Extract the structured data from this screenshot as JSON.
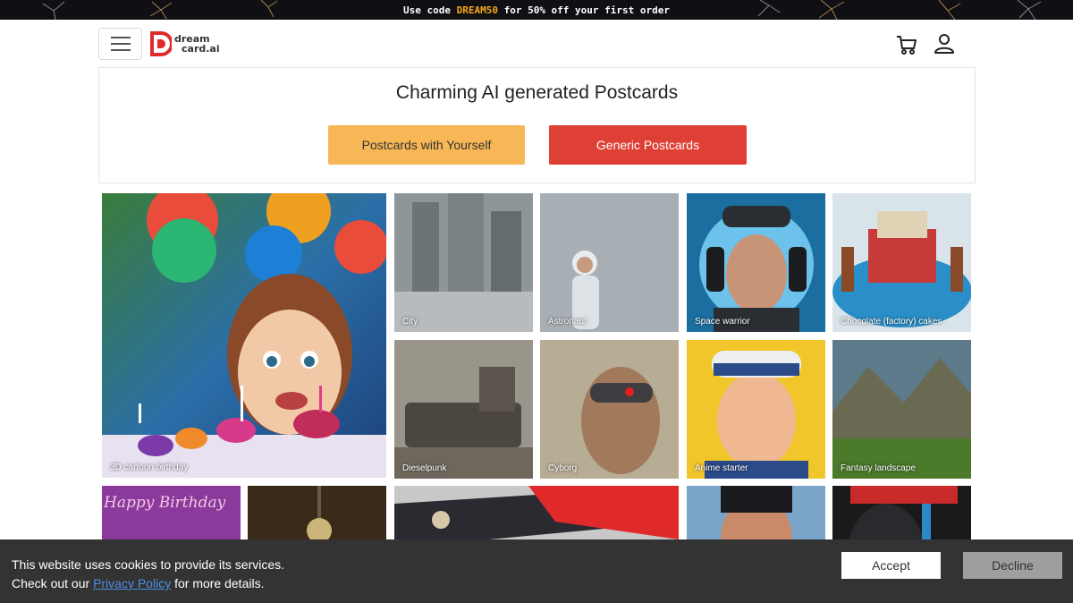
{
  "promo": {
    "prefix": "Use code",
    "code": "DREAM50",
    "suffix": "for 50% off your first order"
  },
  "header": {
    "logo_line1": "dream",
    "logo_line2": "card.ai",
    "menu_icon": "hamburger-icon",
    "cart_icon": "cart-icon",
    "user_icon": "user-icon"
  },
  "hero": {
    "title": "Charming AI generated Postcards",
    "btn_yourself": "Postcards with Yourself",
    "btn_generic": "Generic Postcards"
  },
  "cards": [
    {
      "caption": "3D cartoon birthday"
    },
    {
      "caption": "City"
    },
    {
      "caption": "Astronaut"
    },
    {
      "caption": "Space warrior"
    },
    {
      "caption": "Chocolate (factory) cakes"
    },
    {
      "caption": "Dieselpunk"
    },
    {
      "caption": "Cyborg"
    },
    {
      "caption": "Anime starter"
    },
    {
      "caption": "Fantasy landscape"
    },
    {
      "caption": "",
      "art_text": "Happy Birthday"
    },
    {
      "caption": ""
    },
    {
      "caption": ""
    },
    {
      "caption": ""
    },
    {
      "caption": ""
    }
  ],
  "cookie": {
    "line1": "This website uses cookies to provide its services.",
    "line2_prefix": "Check out our",
    "link": "Privacy Policy",
    "line2_suffix": "for more details.",
    "accept": "Accept",
    "decline": "Decline"
  },
  "colors": {
    "accent_orange": "#f8b756",
    "accent_red": "#df4036",
    "brand_red": "#df2a2a",
    "promo_code": "#f7a81b",
    "cookie_bg": "#333333"
  }
}
